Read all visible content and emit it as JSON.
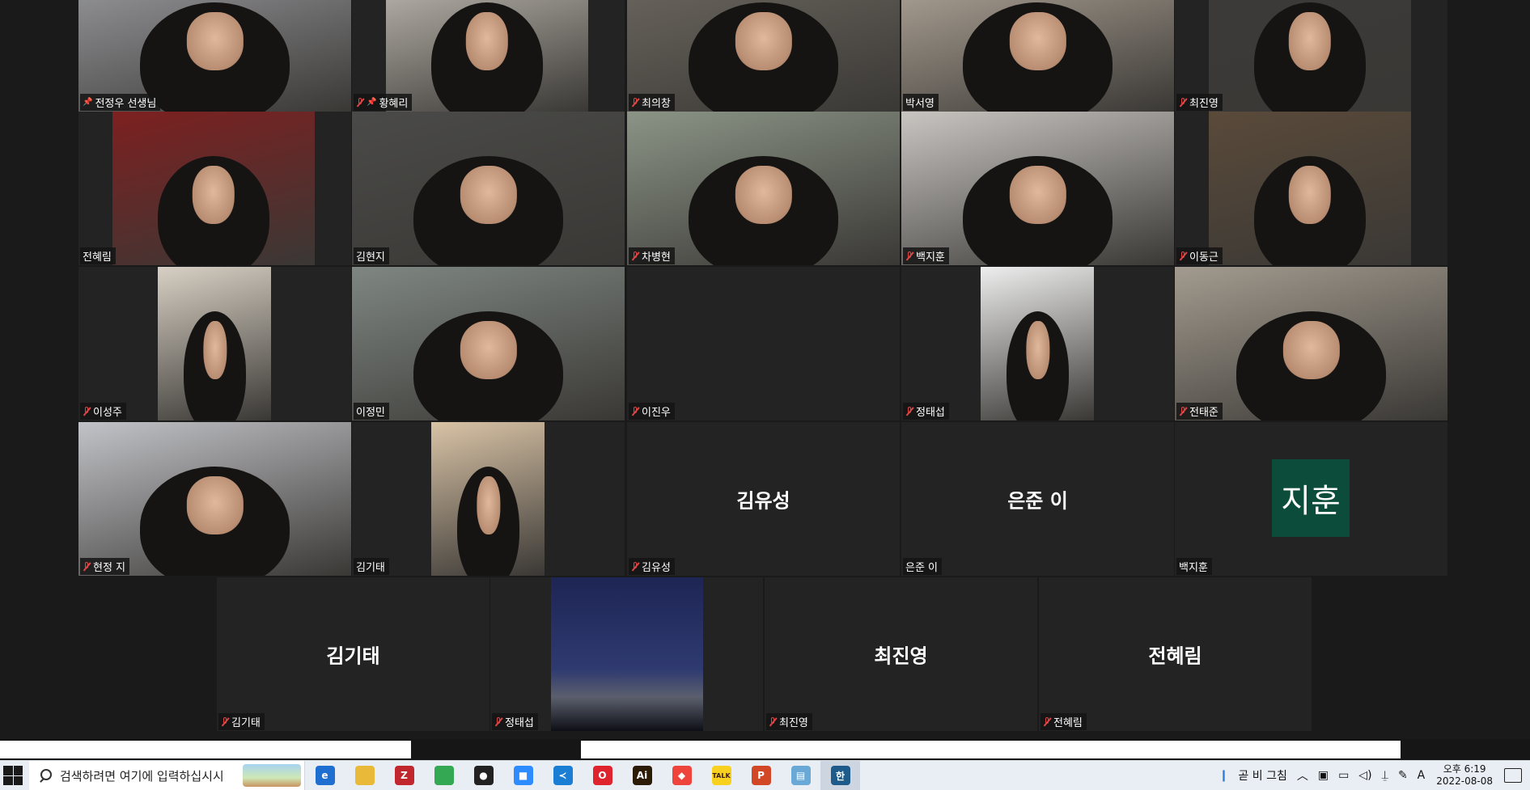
{
  "participants": [
    {
      "name": "전정우 선생님",
      "muted": false,
      "pinned": true,
      "active": true
    },
    {
      "name": "황혜리",
      "muted": true,
      "pinned": true
    },
    {
      "name": "최의창",
      "muted": true
    },
    {
      "name": "박서영",
      "muted": false
    },
    {
      "name": "최진영",
      "muted": true
    },
    {
      "name": "전혜림",
      "muted": false
    },
    {
      "name": "김현지",
      "muted": false
    },
    {
      "name": "차병현",
      "muted": true
    },
    {
      "name": "백지훈",
      "muted": true
    },
    {
      "name": "이동근",
      "muted": true
    },
    {
      "name": "이성주",
      "muted": true
    },
    {
      "name": "이정민",
      "muted": false
    },
    {
      "name": "이진우",
      "muted": true
    },
    {
      "name": "정태섭",
      "muted": true
    },
    {
      "name": "전태준",
      "muted": true
    },
    {
      "name": "현정 지",
      "muted": true
    },
    {
      "name": "김기태",
      "muted": false
    },
    {
      "name": "김유성",
      "muted": true,
      "display": "김유성"
    },
    {
      "name": "은준 이",
      "muted": false,
      "display": "은준 이"
    },
    {
      "name": "백지훈",
      "muted": false,
      "avatar": "지훈"
    },
    {
      "name": "김기태",
      "muted": true,
      "display": "김기태"
    },
    {
      "name": "정태섭",
      "muted": true
    },
    {
      "name": "최진영",
      "muted": true,
      "display": "최진영"
    },
    {
      "name": "전혜림",
      "muted": true,
      "display": "전혜림"
    }
  ],
  "taskbar": {
    "search_placeholder": "검색하려면 여기에 입력하십시시",
    "apps": [
      {
        "icon": "edge-icon",
        "glyph": "e",
        "color": "#1f6fd1"
      },
      {
        "icon": "folder-icon",
        "glyph": "",
        "color": "#e9b93a"
      },
      {
        "icon": "filezilla-icon",
        "glyph": "Z",
        "color": "#c0282d"
      },
      {
        "icon": "chrome-icon",
        "glyph": "",
        "color": "#34a853"
      },
      {
        "icon": "github-desktop-icon",
        "glyph": "●",
        "color": "#222"
      },
      {
        "icon": "zoom-icon",
        "glyph": "■",
        "color": "#2d8cff"
      },
      {
        "icon": "vscode-icon",
        "glyph": "≺",
        "color": "#1a7fd4"
      },
      {
        "icon": "opera-icon",
        "glyph": "O",
        "color": "#e0242e"
      },
      {
        "icon": "illustrator-icon",
        "glyph": "Ai",
        "color": "#2b1b07"
      },
      {
        "icon": "anydesk-icon",
        "glyph": "◆",
        "color": "#ef443b"
      },
      {
        "icon": "kakaotalk-icon",
        "glyph": "TALK",
        "color": "#f7d11e"
      },
      {
        "icon": "powerpoint-icon",
        "glyph": "P",
        "color": "#d24726"
      },
      {
        "icon": "notepad-icon",
        "glyph": "▤",
        "color": "#6aa9d6"
      },
      {
        "icon": "hwp-icon",
        "glyph": "한",
        "color": "#1f5b8a"
      }
    ],
    "tray_text": "곧 비 그침",
    "ime_label": "A",
    "time": "오후 6:19",
    "date": "2022-08-08"
  }
}
